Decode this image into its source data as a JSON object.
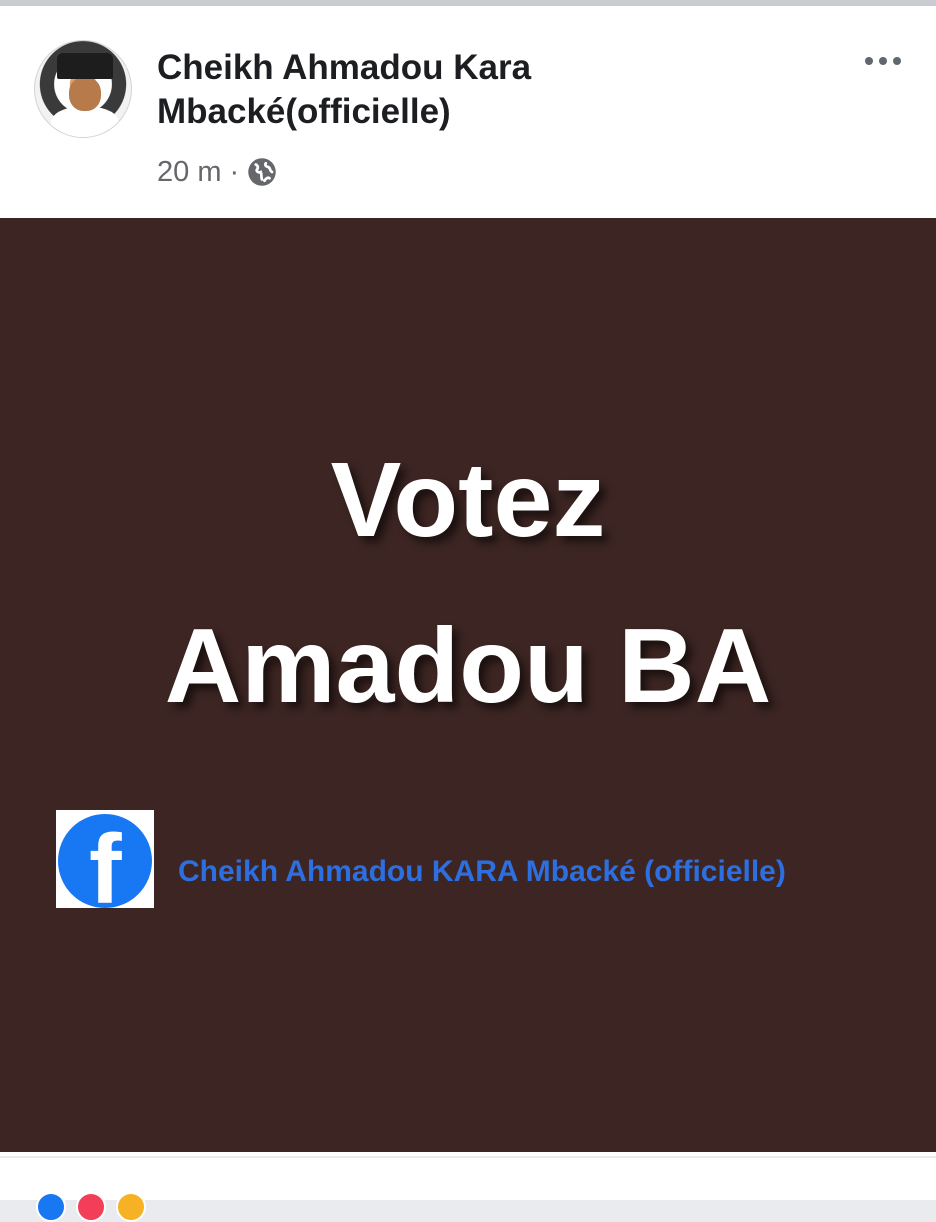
{
  "post": {
    "author": {
      "name": "Cheikh Ahmadou Kara Mbacké(officielle)"
    },
    "time": "20 m",
    "separator": "·",
    "audience_icon": "globe-icon",
    "more_icon": "more-options-icon"
  },
  "image": {
    "background_color": "#3c2522",
    "headline_line1": "Votez",
    "headline_line2": "Amadou BA",
    "page_icon": "facebook-icon",
    "page_name": "Cheikh Ahmadou KARA Mbacké (officielle)"
  },
  "colors": {
    "facebook_blue": "#1877f2",
    "page_name_color": "#2d6fe0"
  },
  "reactions": [
    "like-icon",
    "love-icon",
    "haha-icon"
  ]
}
